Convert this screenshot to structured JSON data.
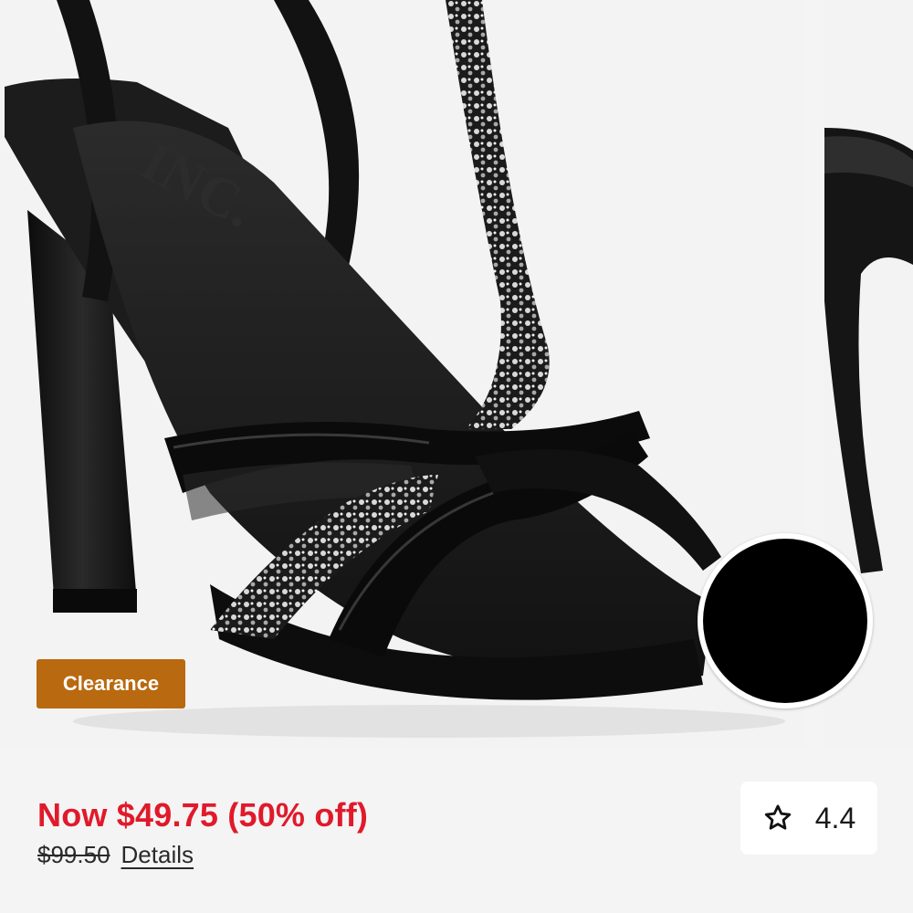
{
  "product": {
    "brand_logo_text": "INC.",
    "badge_label": "Clearance",
    "swatch_color": "#000000",
    "sale_price_text": "Now $49.75 (50% off)",
    "original_price": "$99.50",
    "details_link": "Details",
    "rating": "4.4"
  },
  "icons": {
    "rating_icon": "star-outline-icon"
  },
  "colors": {
    "sale_red": "#e01a2b",
    "clearance_bg": "#b9690f"
  }
}
